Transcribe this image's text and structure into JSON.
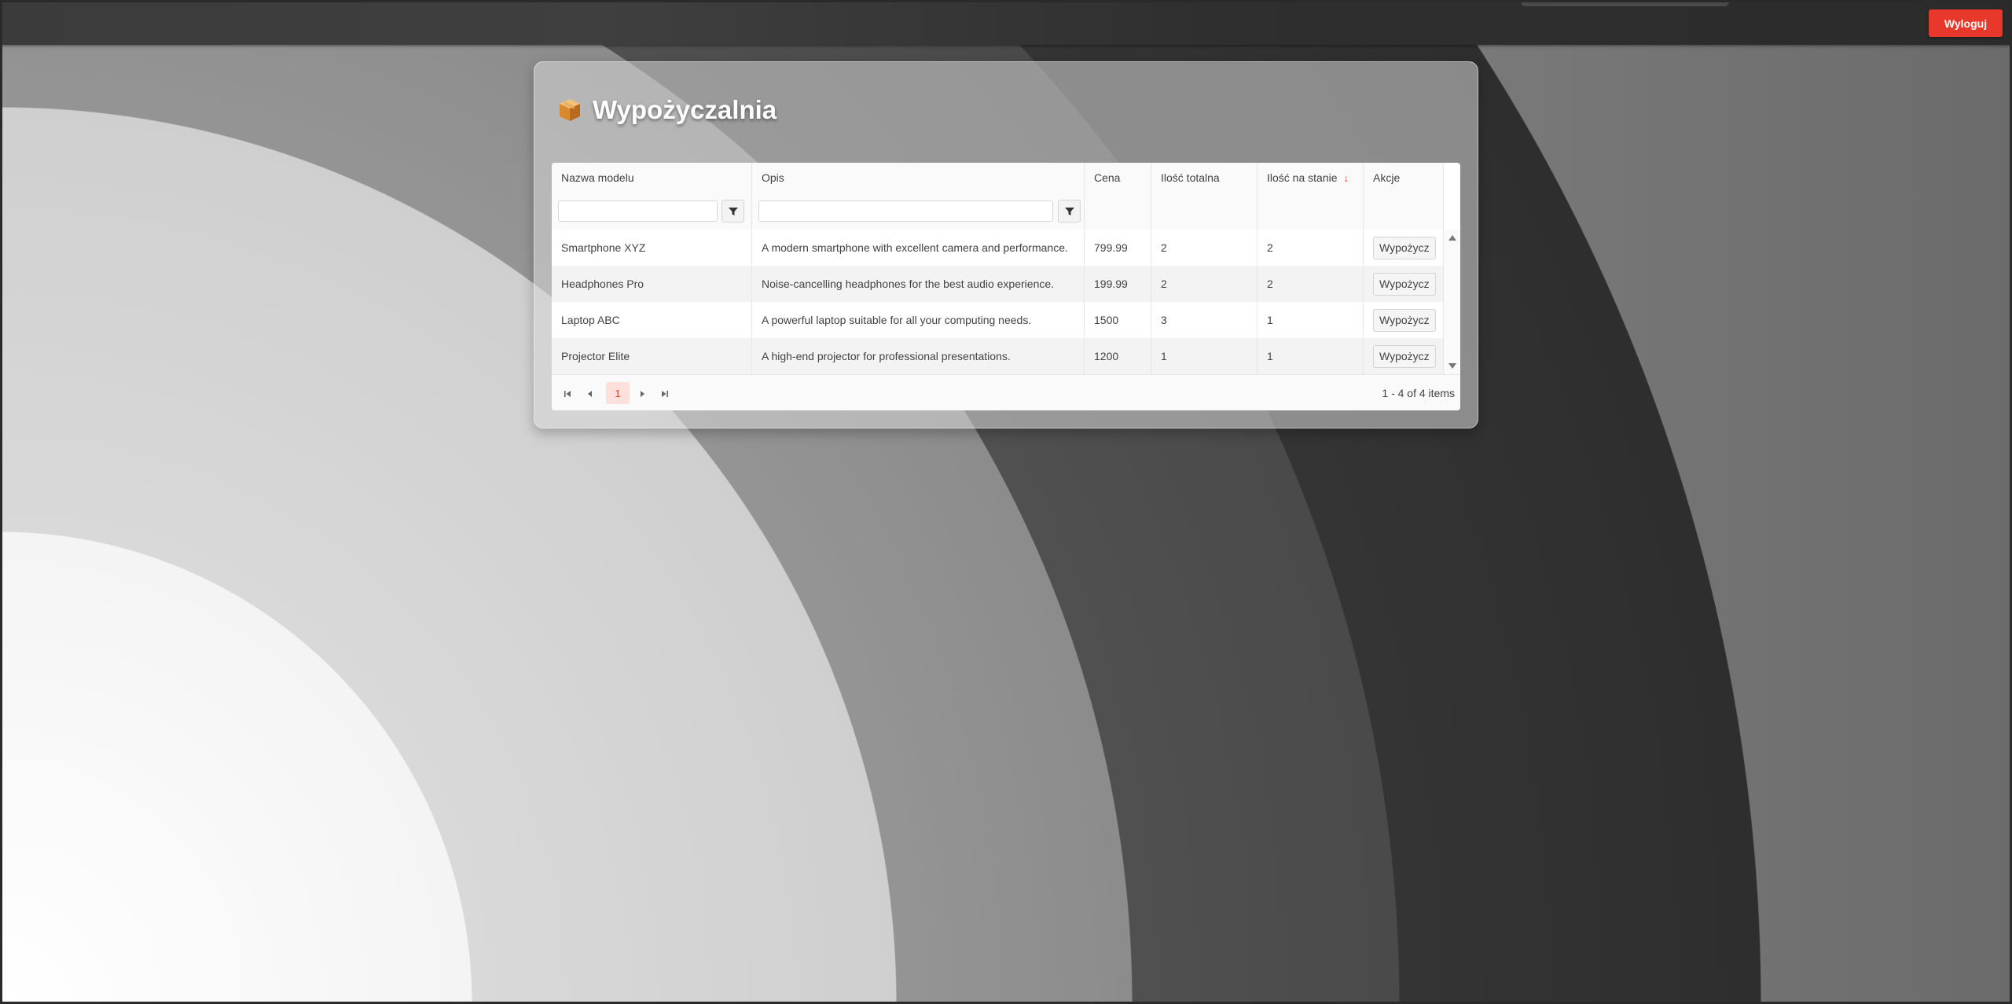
{
  "header": {
    "logout_label": "Wyloguj"
  },
  "panel": {
    "title": "Wypożyczalnia",
    "icon": "package-box-icon"
  },
  "grid": {
    "columns": [
      {
        "label": "Nazwa modelu"
      },
      {
        "label": "Opis"
      },
      {
        "label": "Cena"
      },
      {
        "label": "Ilość totalna"
      },
      {
        "label": "Ilość na stanie",
        "sorted": "descending"
      },
      {
        "label": "Akcje"
      }
    ],
    "rows": [
      {
        "name": "Smartphone XYZ",
        "description": "A modern smartphone with excellent camera and performance.",
        "price": "799.99",
        "total": "2",
        "in_stock": "2",
        "action": "Wypożycz"
      },
      {
        "name": "Headphones Pro",
        "description": "Noise-cancelling headphones for the best audio experience.",
        "price": "199.99",
        "total": "2",
        "in_stock": "2",
        "action": "Wypożycz"
      },
      {
        "name": "Laptop ABC",
        "description": "A powerful laptop suitable for all your computing needs.",
        "price": "1500",
        "total": "3",
        "in_stock": "1",
        "action": "Wypożycz"
      },
      {
        "name": "Projector Elite",
        "description": "A high-end projector for professional presentations.",
        "price": "1200",
        "total": "1",
        "in_stock": "1",
        "action": "Wypożycz"
      }
    ],
    "pager": {
      "current_page": "1",
      "info": "1 - 4 of 4 items"
    }
  },
  "colors": {
    "accent": "#e8382b",
    "title_text": "#ffffff",
    "alt_row": "#f3f3f3"
  }
}
